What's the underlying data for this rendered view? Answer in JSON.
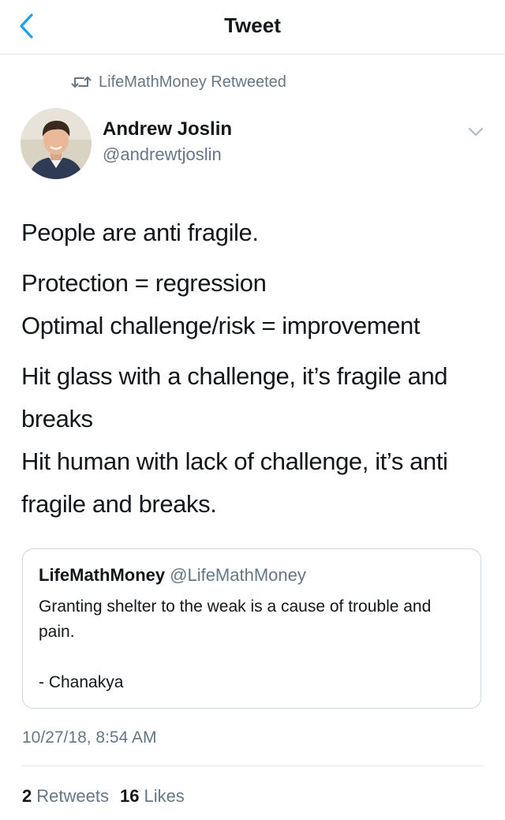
{
  "nav": {
    "title": "Tweet",
    "back_icon": "chevron-left-icon"
  },
  "retweet": {
    "icon": "retweet-icon",
    "text": "LifeMathMoney Retweeted"
  },
  "author": {
    "name": "Andrew Joslin",
    "handle": "@andrewtjoslin",
    "avatar_icon": "avatar"
  },
  "tweet": {
    "line1": "People are anti fragile.",
    "line2": "Protection = regression",
    "line3": "Optimal challenge/risk = improvement",
    "line4": "Hit glass with a challenge, it’s fragile and breaks",
    "line5": "Hit human with lack of challenge, it’s anti fragile and breaks."
  },
  "quote": {
    "name": "LifeMathMoney",
    "handle": "@LifeMathMoney",
    "text": "Granting shelter to the weak is a cause of trouble and pain.",
    "signature": "- Chanakya"
  },
  "timestamp": "10/27/18, 8:54 AM",
  "stats": {
    "retweets_count": "2",
    "retweets_label": "Retweets",
    "likes_count": "16",
    "likes_label": "Likes"
  },
  "colors": {
    "accent": "#1da1f2",
    "secondary": "#657786",
    "border": "#e1e8ed"
  }
}
